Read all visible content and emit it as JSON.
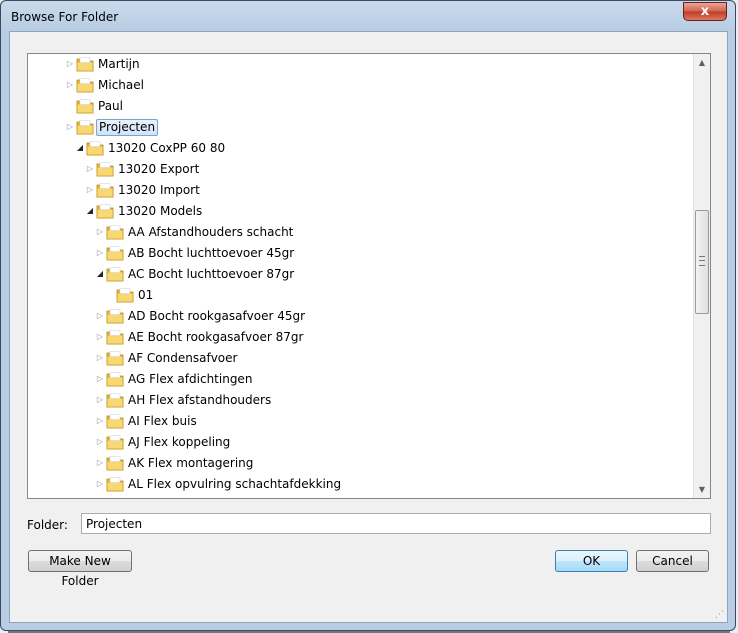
{
  "window": {
    "title": "Browse For Folder",
    "close_glyph": "x"
  },
  "tree": {
    "items": [
      {
        "label": "Martijn",
        "expander": "collapsed",
        "level": 0
      },
      {
        "label": "Michael",
        "expander": "collapsed",
        "level": 0
      },
      {
        "label": "Paul",
        "expander": "none",
        "level": 0
      },
      {
        "label": "Projecten",
        "expander": "collapsed",
        "level": 0,
        "selected": true
      },
      {
        "label": "13020 CoxPP 60 80",
        "expander": "expanded",
        "level": 1
      },
      {
        "label": "13020 Export",
        "expander": "collapsed",
        "level": 2
      },
      {
        "label": "13020 Import",
        "expander": "collapsed",
        "level": 2
      },
      {
        "label": "13020 Models",
        "expander": "expanded",
        "level": 2
      },
      {
        "label": "AA Afstandhouders schacht",
        "expander": "collapsed",
        "level": 3
      },
      {
        "label": "AB Bocht luchttoevoer 45gr",
        "expander": "collapsed",
        "level": 3
      },
      {
        "label": "AC Bocht luchttoevoer 87gr",
        "expander": "expanded",
        "level": 3
      },
      {
        "label": "01",
        "expander": "none",
        "level": 4
      },
      {
        "label": "AD Bocht rookgasafvoer 45gr",
        "expander": "collapsed",
        "level": 3
      },
      {
        "label": "AE Bocht rookgasafvoer 87gr",
        "expander": "collapsed",
        "level": 3
      },
      {
        "label": "AF Condensafvoer",
        "expander": "collapsed",
        "level": 3
      },
      {
        "label": "AG Flex afdichtingen",
        "expander": "collapsed",
        "level": 3
      },
      {
        "label": "AH Flex afstandhouders",
        "expander": "collapsed",
        "level": 3
      },
      {
        "label": "AI Flex buis",
        "expander": "collapsed",
        "level": 3
      },
      {
        "label": "AJ Flex koppeling",
        "expander": "collapsed",
        "level": 3
      },
      {
        "label": "AK Flex montagering",
        "expander": "collapsed",
        "level": 3
      },
      {
        "label": "AL Flex opvulring schachtafdekking",
        "expander": "collapsed",
        "level": 3
      }
    ]
  },
  "folder_field": {
    "label": "Folder:",
    "value": "Projecten"
  },
  "buttons": {
    "make_new_folder": "Make New Folder",
    "ok": "OK",
    "cancel": "Cancel"
  },
  "icons": {
    "folder": "folder-icon",
    "expand": "triangle-right-icon",
    "collapse": "triangle-down-icon",
    "close": "close-icon"
  },
  "colors": {
    "folder_yellow": "#f2c94c",
    "selection_border": "#7da2ce",
    "title_gradient": "#b8cde3"
  }
}
